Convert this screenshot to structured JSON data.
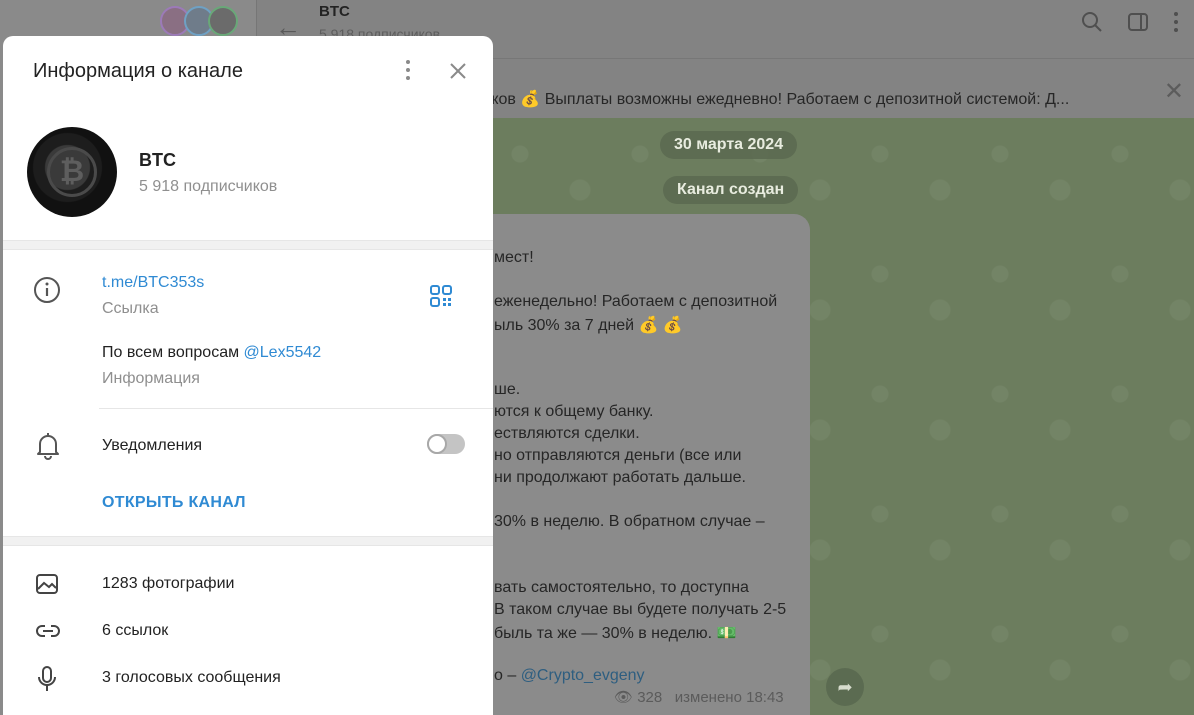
{
  "background": {
    "header": {
      "title": "BTC",
      "subtitle": "5 918 подписчиков"
    },
    "pinned": {
      "text": "чков  💰 Выплаты возможны ежедневно! Работаем с депозитной системой:  Д..."
    },
    "date_pill": "30 марта 2024",
    "created_pill": "Канал создан",
    "message_lines": [
      "мест!",
      "еженедельно! Работаем с депозитной",
      "ыль 30% за 7 дней 💰 💰",
      "ше.",
      "ются к общему банку.",
      "ествляются сделки.",
      "но отправляются деньги (все или",
      "ни продолжают работать дальше.",
      "30% в неделю. В обратном случае –",
      "вать самостоятельно, то доступна",
      "В таком случае вы будете получать 2-5",
      "быль та же — 30% в неделю. 💵"
    ],
    "message_author_prefix": "о – ",
    "message_author": "@Crypto_evgeny",
    "views": "328",
    "edited": "изменено 18:43"
  },
  "panel": {
    "title": "Информация о канале",
    "channel": {
      "name": "BTC",
      "subscribers": "5 918 подписчиков"
    },
    "link": {
      "value": "t.me/BTC353s",
      "label": "Ссылка"
    },
    "about": {
      "text": "По всем вопросам ",
      "mention": "@Lex5542",
      "label": "Информация"
    },
    "notifications": {
      "label": "Уведомления",
      "enabled": false
    },
    "open_channel": "ОТКРЫТЬ КАНАЛ",
    "media": [
      {
        "icon": "photo-icon",
        "label": "1283 фотографии"
      },
      {
        "icon": "link-icon",
        "label": "6 ссылок"
      },
      {
        "icon": "microphone-icon",
        "label": "3 голосовых сообщения"
      }
    ]
  }
}
